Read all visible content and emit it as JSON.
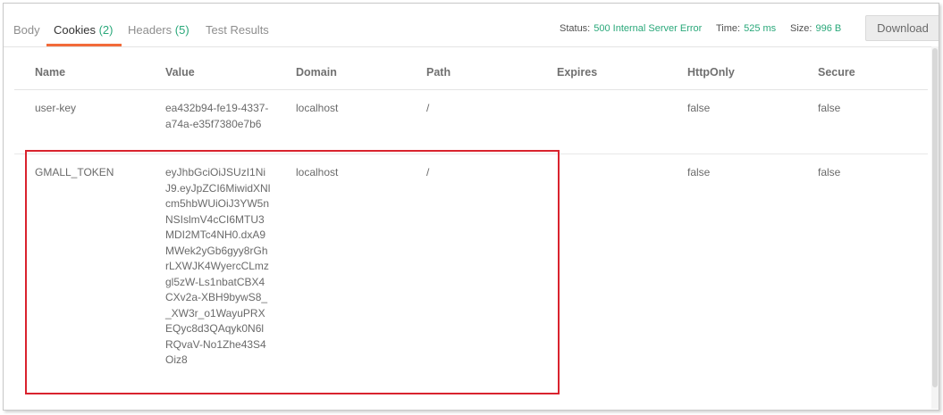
{
  "tabs": [
    {
      "label": "Body",
      "count": ""
    },
    {
      "label": "Cookies",
      "count": "(2)"
    },
    {
      "label": "Headers",
      "count": "(5)"
    },
    {
      "label": "Test Results",
      "count": ""
    }
  ],
  "status": {
    "status_label": "Status:",
    "status_value": "500 Internal Server Error",
    "time_label": "Time:",
    "time_value": "525 ms",
    "size_label": "Size:",
    "size_value": "996 B"
  },
  "download_label": "Download",
  "columns": [
    "Name",
    "Value",
    "Domain",
    "Path",
    "Expires",
    "HttpOnly",
    "Secure"
  ],
  "rows": [
    {
      "name": "user-key",
      "value": "ea432b94-fe19-4337-a74a-e35f7380e7b6",
      "domain": "localhost",
      "path": "/",
      "expires": "",
      "httponly": "false",
      "secure": "false"
    },
    {
      "name": "GMALL_TOKEN",
      "value": "eyJhbGciOiJSUzI1NiJ9.eyJpZCI6MiwidXNlcm5hbWUiOiJ3YW5nNSIslmV4cCI6MTU3MDI2MTc4NH0.dxA9MWek2yGb6gyy8rGhrLXWJK4WyercCLmzgl5zW-Ls1nbatCBX4CXv2a-XBH9bywS8__XW3r_o1WayuPRXEQyc8d3QAqyk0N6lRQvaV-No1Zhe43S4Oiz8",
      "domain": "localhost",
      "path": "/",
      "expires": "",
      "httponly": "false",
      "secure": "false"
    }
  ]
}
